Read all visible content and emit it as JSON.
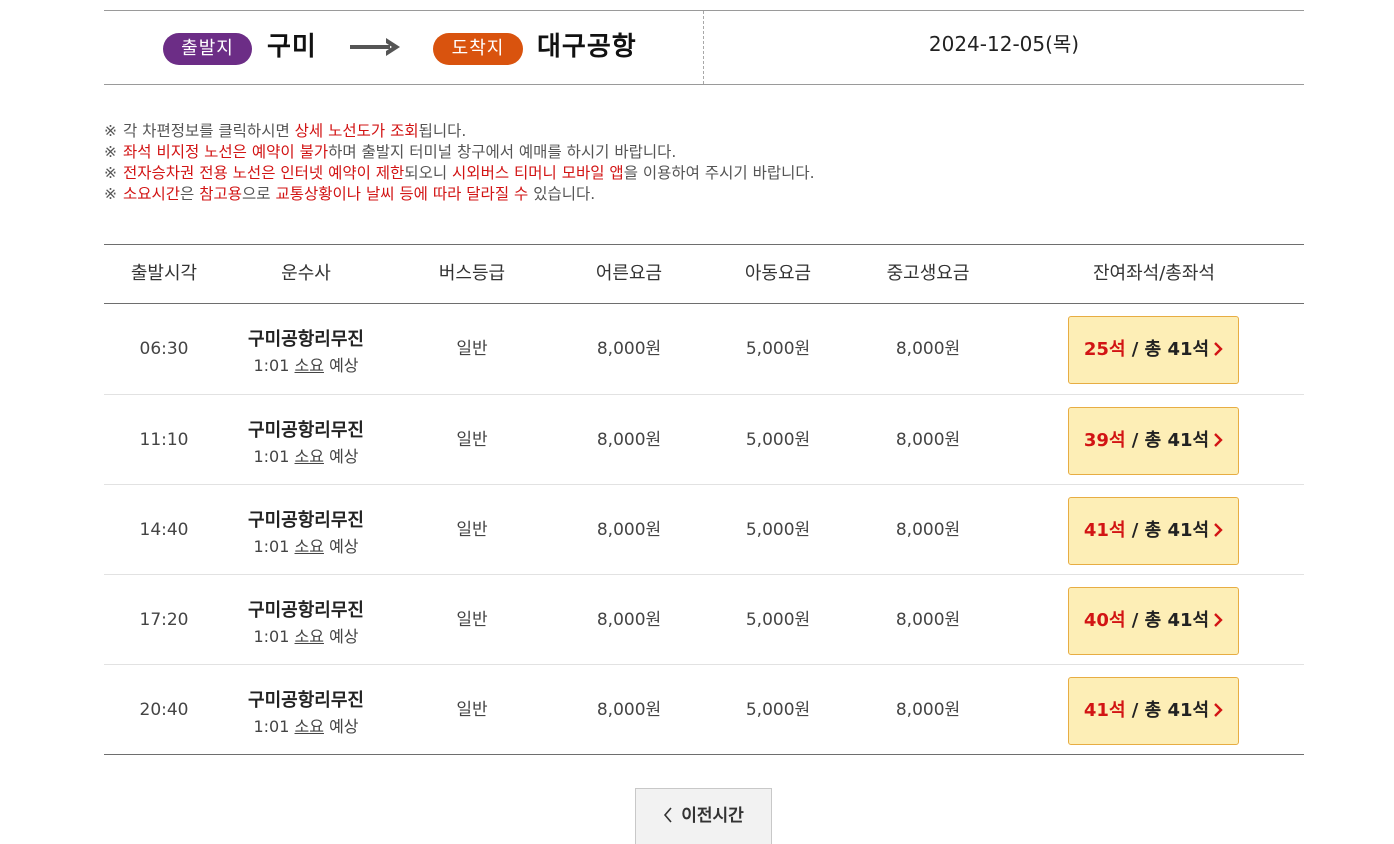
{
  "route": {
    "departure_badge": "출발지",
    "departure": "구미",
    "arrival_badge": "도착지",
    "arrival": "대구공항",
    "date": "2024-12-05(목)",
    "colors": {
      "departure_badge": "#6c2d86",
      "arrival_badge": "#d9530e"
    }
  },
  "notices": [
    {
      "mark": "※",
      "parts": [
        {
          "t": "각 차편정보를 클릭하시면 ",
          "hl": false
        },
        {
          "t": "상세 노선도가 조회",
          "hl": true
        },
        {
          "t": "됩니다.",
          "hl": false
        }
      ]
    },
    {
      "mark": "※",
      "parts": [
        {
          "t": "좌석 비지정 노선은 예약이 불가",
          "hl": true
        },
        {
          "t": "하며 출발지 터미널 창구에서 예매를 하시기 바랍니다.",
          "hl": false
        }
      ]
    },
    {
      "mark": "※",
      "parts": [
        {
          "t": "전자승차권 전용 노선은 인터넷 예약이 제한",
          "hl": true
        },
        {
          "t": "되오니 ",
          "hl": false
        },
        {
          "t": "시외버스 티머니 모바일 앱",
          "hl": true
        },
        {
          "t": "을 이용하여 주시기 바랍니다.",
          "hl": false
        }
      ]
    },
    {
      "mark": "※",
      "parts": [
        {
          "t": "소요시간",
          "hl": true
        },
        {
          "t": "은 ",
          "hl": false
        },
        {
          "t": "참고용",
          "hl": true
        },
        {
          "t": "으로 ",
          "hl": false
        },
        {
          "t": "교통상황이나 날씨 등에 따라 달라질 수",
          "hl": true
        },
        {
          "t": " 있습니다.",
          "hl": false
        }
      ]
    }
  ],
  "table": {
    "headers": [
      "출발시각",
      "운수사",
      "버스등급",
      "어른요금",
      "아동요금",
      "중고생요금",
      "잔여좌석/총좌석"
    ],
    "rows": [
      {
        "time": "06:30",
        "company": "구미공항리무진",
        "dur_time": "1:01",
        "dur_text": "소요",
        "dur_suffix": "예상",
        "grade": "일반",
        "adult": "8,000원",
        "child": "5,000원",
        "youth": "8,000원",
        "remaining": "25석",
        "total": "/ 총 41석"
      },
      {
        "time": "11:10",
        "company": "구미공항리무진",
        "dur_time": "1:01",
        "dur_text": "소요",
        "dur_suffix": "예상",
        "grade": "일반",
        "adult": "8,000원",
        "child": "5,000원",
        "youth": "8,000원",
        "remaining": "39석",
        "total": "/ 총 41석"
      },
      {
        "time": "14:40",
        "company": "구미공항리무진",
        "dur_time": "1:01",
        "dur_text": "소요",
        "dur_suffix": "예상",
        "grade": "일반",
        "adult": "8,000원",
        "child": "5,000원",
        "youth": "8,000원",
        "remaining": "41석",
        "total": "/ 총 41석"
      },
      {
        "time": "17:20",
        "company": "구미공항리무진",
        "dur_time": "1:01",
        "dur_text": "소요",
        "dur_suffix": "예상",
        "grade": "일반",
        "adult": "8,000원",
        "child": "5,000원",
        "youth": "8,000원",
        "remaining": "40석",
        "total": "/ 총 41석"
      },
      {
        "time": "20:40",
        "company": "구미공항리무진",
        "dur_time": "1:01",
        "dur_text": "소요",
        "dur_suffix": "예상",
        "grade": "일반",
        "adult": "8,000원",
        "child": "5,000원",
        "youth": "8,000원",
        "remaining": "41석",
        "total": "/ 총 41석"
      }
    ]
  },
  "prev_button": {
    "label": "이전시간",
    "icon": "chevron-left-icon"
  },
  "colors": {
    "highlight": "#d21414",
    "seat_button_bg": "#fdeeb6",
    "seat_button_border": "#e7ad43"
  }
}
